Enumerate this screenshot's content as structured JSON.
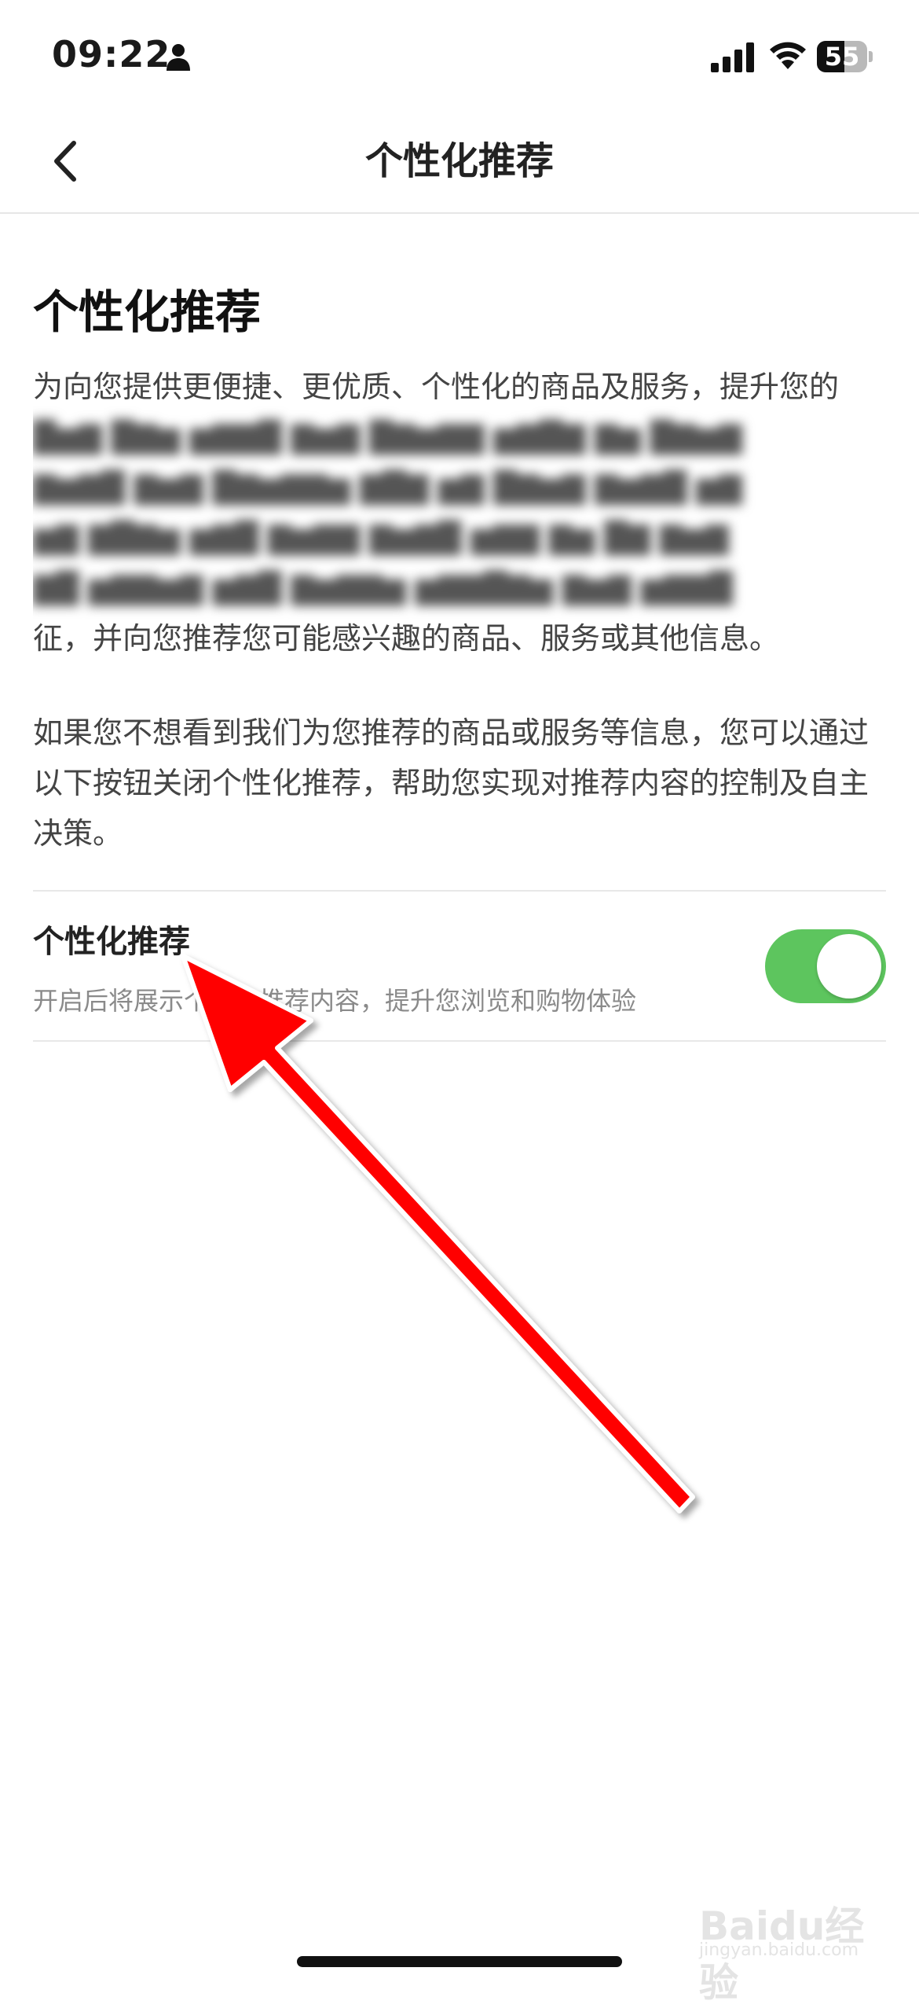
{
  "status_bar": {
    "time": "09:22",
    "battery_level": 55,
    "battery_text": "55"
  },
  "nav": {
    "title": "个性化推荐",
    "back_icon": "chevron-left-icon"
  },
  "content": {
    "section_title": "个性化推荐",
    "intro_first_line": "为向您提供更便捷、更优质、个性化的商品及服务，提升您的",
    "intro_last_line": "征，并向您推荐您可能感兴趣的商品、服务或其他信息。",
    "paragraph_2": "如果您不想看到我们为您推荐的商品或服务等信息，您可以通过以下按钮关闭个性化推荐，帮助您实现对推荐内容的控制及自主决策。"
  },
  "setting": {
    "title": "个性化推荐",
    "description": "开启后将展示个性化推荐内容，提升您浏览和购物体验",
    "enabled": true,
    "on_color": "#5dc55e"
  },
  "annotation": {
    "arrow_color": "#ff0000"
  },
  "watermark": {
    "text": "Baidu经验",
    "sub": "jingyan.baidu.com"
  }
}
